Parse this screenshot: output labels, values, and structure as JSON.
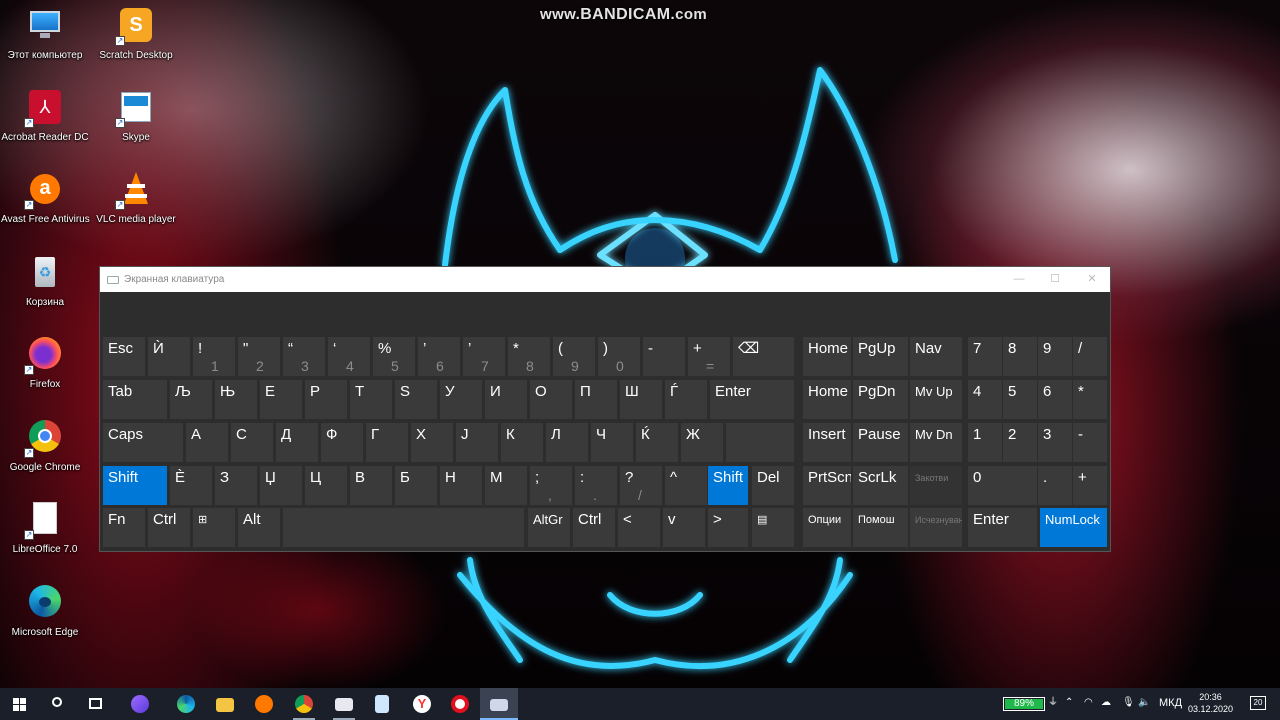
{
  "watermark": {
    "prefix": "www.",
    "brand": "BANDICAM",
    "suffix": ".com"
  },
  "desktop_icons": [
    {
      "label": "Этот компьютер",
      "icon": "computer-icon"
    },
    {
      "label": "Scratch Desktop",
      "icon": "scratch-icon"
    },
    {
      "label": "Acrobat Reader DC",
      "icon": "acrobat-icon"
    },
    {
      "label": "Skype",
      "icon": "skype-icon"
    },
    {
      "label": "Avast Free Antivirus",
      "icon": "avast-icon"
    },
    {
      "label": "VLC media player",
      "icon": "vlc-icon"
    },
    {
      "label": "Корзина",
      "icon": "recycle-bin-icon"
    },
    {
      "label": "Firefox",
      "icon": "firefox-icon"
    },
    {
      "label": "Google Chrome",
      "icon": "chrome-icon"
    },
    {
      "label": "LibreOffice 7.0",
      "icon": "libreoffice-icon"
    },
    {
      "label": "Microsoft Edge",
      "icon": "edge-icon"
    }
  ],
  "osk": {
    "title": "Экранная клавиатура",
    "row1": [
      {
        "main": "Esc"
      },
      {
        "main": "Ѝ"
      },
      {
        "main": "!",
        "sub": "1"
      },
      {
        "main": "\"",
        "sub": "2",
        "small": "„"
      },
      {
        "main": "“",
        "sub": "3"
      },
      {
        "main": "‘",
        "sub": "4"
      },
      {
        "main": "%",
        "sub": "5"
      },
      {
        "main": "’",
        "sub": "6"
      },
      {
        "main": "’",
        "sub": "7"
      },
      {
        "main": "*",
        "sub": "8"
      },
      {
        "main": "(",
        "sub": "9"
      },
      {
        "main": ")",
        "sub": "0"
      },
      {
        "main": "-"
      },
      {
        "main": "+",
        "sub": "="
      },
      {
        "main": "⌫"
      }
    ],
    "row2": [
      "Tab",
      "Љ",
      "Њ",
      "Е",
      "Р",
      "Т",
      "Ѕ",
      "У",
      "И",
      "О",
      "П",
      "Ш",
      "Ѓ",
      "Enter"
    ],
    "row3": [
      "Caps",
      "А",
      "С",
      "Д",
      "Ф",
      "Г",
      "Х",
      "Ј",
      "К",
      "Л",
      "Ч",
      "Ќ",
      "Ж"
    ],
    "row4": [
      {
        "main": "Shift"
      },
      {
        "main": "Ѐ"
      },
      {
        "main": "З"
      },
      {
        "main": "Џ"
      },
      {
        "main": "Ц"
      },
      {
        "main": "В"
      },
      {
        "main": "Б"
      },
      {
        "main": "Н"
      },
      {
        "main": "М"
      },
      {
        "main": ";",
        "sub": ","
      },
      {
        "main": ":",
        "sub": "."
      },
      {
        "main": "?",
        "sub": "/"
      },
      {
        "main": "^"
      },
      {
        "main": "Shift"
      },
      {
        "main": "Del"
      }
    ],
    "row5": [
      "Fn",
      "Ctrl",
      "⊞",
      "Alt",
      "",
      "AltGr",
      "Ctrl",
      "<",
      "v",
      ">",
      "▤"
    ],
    "nav": [
      [
        "Home",
        "PgUp",
        "Nav"
      ],
      [
        "Home",
        "PgDn",
        "Mv Up"
      ],
      [
        "Insert",
        "Pause",
        "Mv Dn"
      ],
      [
        "PrtScn",
        "ScrLk",
        "Закотви"
      ],
      [
        "Опции",
        "Помош",
        "Исчезнување"
      ]
    ],
    "numpad": [
      [
        "7",
        "8",
        "9",
        "/"
      ],
      [
        "4",
        "5",
        "6",
        "*"
      ],
      [
        "1",
        "2",
        "3",
        "-"
      ],
      [
        "0",
        ".",
        "+"
      ],
      [
        "Enter",
        "NumLock"
      ]
    ]
  },
  "taskbar": {
    "apps": [
      "start-icon",
      "search-icon",
      "task-view-icon",
      "alice-icon",
      "edge-icon",
      "file-explorer-icon",
      "avast-icon",
      "chrome-icon",
      "email-icon",
      "notepad-icon",
      "yandex-icon",
      "record-icon",
      "osk-icon"
    ],
    "battery": "89%",
    "language": "МКД",
    "time": "20:36",
    "date": "03.12.2020",
    "notifications": "20"
  },
  "colors": {
    "accent": "#0078d7",
    "key": "#3a3a3a",
    "window": "#2d2d2d"
  }
}
